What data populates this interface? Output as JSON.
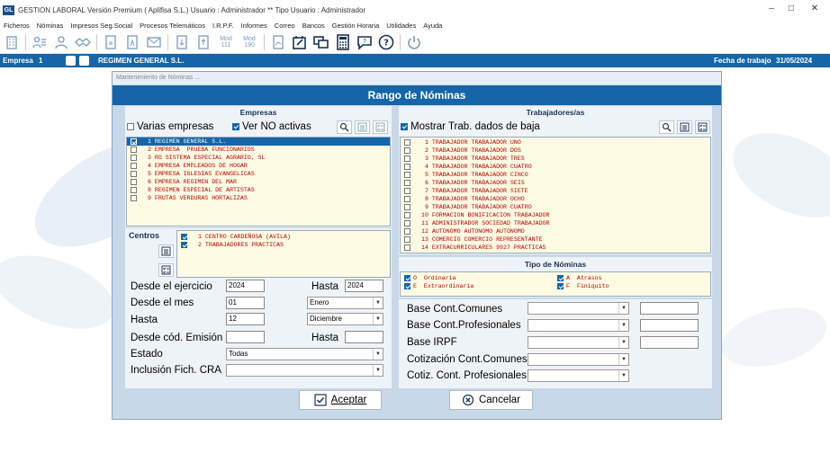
{
  "window": {
    "logo": "GL",
    "title": "GESTION LABORAL Versión Premium ( Aplifisa S.L.)   Usuario : Administrador  **  Tipo Usuario : Administrador"
  },
  "menu": [
    "Ficheros",
    "Nóminas",
    "Impresos Seg.Social",
    "Procesos Telemáticos",
    "I.R.P.F.",
    "Informes",
    "Correo",
    "Bancos",
    "Gestión Horaria",
    "Utilidades",
    "Ayuda"
  ],
  "toolbar": {
    "mod111_a": "Mod",
    "mod111_b": "111",
    "mod190_a": "Mod",
    "mod190_b": "190"
  },
  "companybar": {
    "empresa_label": "Empresa",
    "empresa_num": "1",
    "empresa_name": "REGIMEN GENERAL S.L.",
    "fecha_label": "Fecha de trabajo",
    "fecha_value": "31/05/2024"
  },
  "dialog": {
    "caption": "Mantenimiento de Nóminas ...",
    "title": "Rango de Nóminas",
    "empresas": {
      "title": "Empresas",
      "varias_label": "Varias empresas",
      "ver_no_activas_label": "Ver NO activas",
      "items": [
        {
          "text": "1 REGIMEN GENERAL S.L.",
          "checked": true,
          "selected": true
        },
        {
          "text": "2 EMPRESA  PRUEBA FUNCIONARIOS",
          "checked": false,
          "selected": false
        },
        {
          "text": "3 RG SISTEMA ESPECIAL AGRARIO, SL",
          "checked": false,
          "selected": false
        },
        {
          "text": "4 EMPRESA EMPLEADOS DE HOGAR",
          "checked": false,
          "selected": false
        },
        {
          "text": "5 EMPRESA IGLESIAS EVANGELICAS",
          "checked": false,
          "selected": false
        },
        {
          "text": "6 EMPRESA REGIMEN DEL MAR",
          "checked": false,
          "selected": false
        },
        {
          "text": "8 REGIMEN ESPECIAL DE ARTISTAS",
          "checked": false,
          "selected": false
        },
        {
          "text": "9 FRUTAS VERDURAS HORTALIZAS",
          "checked": false,
          "selected": false
        }
      ]
    },
    "centros": {
      "title": "Centros",
      "items": [
        {
          "text": "1 CENTRO CARDEÑOSA (AVILA)",
          "checked": true
        },
        {
          "text": "2 TRABAJADORES PRACTICAS",
          "checked": true
        }
      ]
    },
    "trabajadores": {
      "title": "Trabajadores/as",
      "mostrar_baja_label": "Mostrar Trab. dados de baja",
      "items": [
        {
          "text": " 1 TRABAJADOR TRABAJADOR UNO"
        },
        {
          "text": " 2 TRABAJADOR TRABAJADOR DOS"
        },
        {
          "text": " 3 TRABAJADOR TRABAJADOR TRES"
        },
        {
          "text": " 4 TRABAJADOR TRABAJADOR CUATRO"
        },
        {
          "text": " 5 TRABAJADOR TRABAJADOR CINCO"
        },
        {
          "text": " 6 TRABAJADOR TRABAJADOR SEIS"
        },
        {
          "text": " 7 TRABAJADOR TRABAJADOR SIETE"
        },
        {
          "text": " 8 TRABAJADOR TRABAJADOR OCHO"
        },
        {
          "text": " 9 TRABAJADOR TRABAJADOR CUATRO"
        },
        {
          "text": "10 FORMACION BONIFICACION TRABAJADOR"
        },
        {
          "text": "11 ADMINISTRADOR SOCIEDAD TRABAJADOR"
        },
        {
          "text": "12 AUTONOMO AUTONOMO AUTONOMO"
        },
        {
          "text": "13 COMERCIO COMERCIO REPRESENTANTE"
        },
        {
          "text": "14 EXTRACURRICULARES 9927 PRACTICAS"
        }
      ]
    },
    "tipo_nominas": {
      "title": "Tipo de Nóminas",
      "items": [
        {
          "code": "O",
          "label": "Ordinaria",
          "checked": true
        },
        {
          "code": "A",
          "label": "Atrasos",
          "checked": true
        },
        {
          "code": "E",
          "label": "Extraordinaria",
          "checked": true
        },
        {
          "code": "F",
          "label": "Finiquito",
          "checked": true
        }
      ]
    },
    "form": {
      "desde_ejercicio_label": "Desde el ejercicio",
      "desde_ejercicio_value": "2024",
      "hasta1_label": "Hasta",
      "hasta_ejercicio_value": "2024",
      "desde_mes_label": "Desde el mes",
      "desde_mes_value": "01",
      "desde_mes_name": "Enero",
      "hasta2_label": "Hasta",
      "hasta_mes_value": "12",
      "hasta_mes_name": "Diciembre",
      "desde_emision_label": "Desde cód. Emisión",
      "desde_emision_value": "",
      "hasta3_label": "Hasta",
      "hasta_emision_value": "",
      "estado_label": "Estado",
      "estado_value": "Todas",
      "inclusion_label": "Inclusión Fich. CRA",
      "inclusion_value": ""
    },
    "bases": {
      "cont_comunes_label": "Base Cont.Comunes",
      "cont_profesionales_label": "Base Cont.Profesionales",
      "irpf_label": "Base IRPF",
      "cotiz_comunes_label": "Cotización Cont.Comunes",
      "cotiz_profesionales_label": "Cotiz. Cont. Profesionales"
    },
    "aceptar_label": "Aceptar",
    "cancelar_label": "Cancelar"
  }
}
